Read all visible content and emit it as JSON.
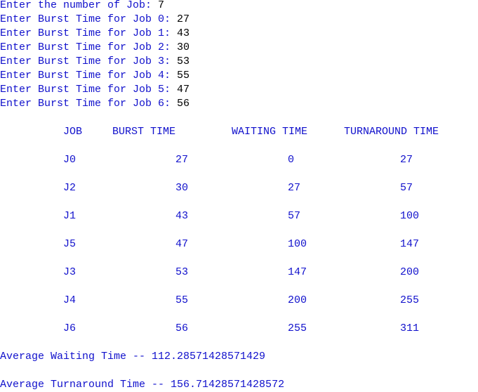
{
  "prompts": [
    {
      "text": "Enter the number of Job: ",
      "value": "7"
    },
    {
      "text": "Enter Burst Time for Job 0: ",
      "value": "27"
    },
    {
      "text": "Enter Burst Time for Job 1: ",
      "value": "43"
    },
    {
      "text": "Enter Burst Time for Job 2: ",
      "value": "30"
    },
    {
      "text": "Enter Burst Time for Job 3: ",
      "value": "53"
    },
    {
      "text": "Enter Burst Time for Job 4: ",
      "value": "55"
    },
    {
      "text": "Enter Burst Time for Job 5: ",
      "value": "47"
    },
    {
      "text": "Enter Burst Time for Job 6: ",
      "value": "56"
    }
  ],
  "table": {
    "headers": [
      "JOB",
      "BURST TIME",
      "WAITING TIME",
      "TURNAROUND TIME"
    ],
    "rows": [
      [
        "J0",
        "27",
        "0",
        "27"
      ],
      [
        "J2",
        "30",
        "27",
        "57"
      ],
      [
        "J1",
        "43",
        "57",
        "100"
      ],
      [
        "J5",
        "47",
        "100",
        "147"
      ],
      [
        "J3",
        "53",
        "147",
        "200"
      ],
      [
        "J4",
        "55",
        "200",
        "255"
      ],
      [
        "J6",
        "56",
        "255",
        "311"
      ]
    ]
  },
  "summary": {
    "avg_waiting": "Average Waiting Time -- 112.28571428571429",
    "avg_turnaround": "Average Turnaround Time -- 156.71428571428572"
  },
  "colors": {
    "output_text": "#1010cc",
    "user_input": "#000000",
    "background": "#ffffff"
  }
}
